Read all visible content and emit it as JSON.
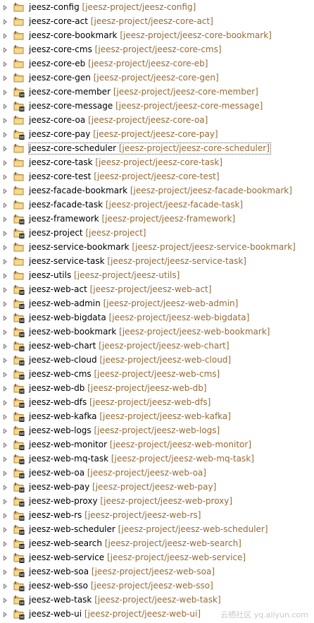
{
  "projects": [
    {
      "name": "jeesz-config",
      "path": "[jeesz-project/jeesz-config]",
      "decorated": false
    },
    {
      "name": "jeesz-core-act",
      "path": "[jeesz-project/jeesz-core-act]",
      "decorated": false
    },
    {
      "name": "jeesz-core-bookmark",
      "path": "[jeesz-project/jeesz-core-bookmark]",
      "decorated": false
    },
    {
      "name": "jeesz-core-cms",
      "path": "[jeesz-project/jeesz-core-cms]",
      "decorated": false
    },
    {
      "name": "jeesz-core-eb",
      "path": "[jeesz-project/jeesz-core-eb]",
      "decorated": false
    },
    {
      "name": "jeesz-core-gen",
      "path": "[jeesz-project/jeesz-core-gen]",
      "decorated": false
    },
    {
      "name": "jeesz-core-member",
      "path": "[jeesz-project/jeesz-core-member]",
      "decorated": true
    },
    {
      "name": "jeesz-core-message",
      "path": "[jeesz-project/jeesz-core-message]",
      "decorated": true
    },
    {
      "name": "jeesz-core-oa",
      "path": "[jeesz-project/jeesz-core-oa]",
      "decorated": false
    },
    {
      "name": "jeesz-core-pay",
      "path": "[jeesz-project/jeesz-core-pay]",
      "decorated": true
    },
    {
      "name": "jeesz-core-scheduler",
      "path": "[jeesz-project/jeesz-core-scheduler]",
      "decorated": false,
      "selected": true
    },
    {
      "name": "jeesz-core-task",
      "path": "[jeesz-project/jeesz-core-task]",
      "decorated": false
    },
    {
      "name": "jeesz-core-test",
      "path": "[jeesz-project/jeesz-core-test]",
      "decorated": false
    },
    {
      "name": "jeesz-facade-bookmark",
      "path": "[jeesz-project/jeesz-facade-bookmark]",
      "decorated": false
    },
    {
      "name": "jeesz-facade-task",
      "path": "[jeesz-project/jeesz-facade-task]",
      "decorated": false
    },
    {
      "name": "jeesz-framework",
      "path": "[jeesz-project/jeesz-framework]",
      "decorated": true
    },
    {
      "name": "jeesz-project",
      "path": "[jeesz-project]",
      "decorated": true
    },
    {
      "name": "jeesz-service-bookmark",
      "path": "[jeesz-project/jeesz-service-bookmark]",
      "decorated": false
    },
    {
      "name": "jeesz-service-task",
      "path": "[jeesz-project/jeesz-service-task]",
      "decorated": false
    },
    {
      "name": "jeesz-utils",
      "path": "[jeesz-project/jeesz-utils]",
      "decorated": false
    },
    {
      "name": "jeesz-web-act",
      "path": "[jeesz-project/jeesz-web-act]",
      "decorated": true
    },
    {
      "name": "jeesz-web-admin",
      "path": "[jeesz-project/jeesz-web-admin]",
      "decorated": true
    },
    {
      "name": "jeesz-web-bigdata",
      "path": "[jeesz-project/jeesz-web-bigdata]",
      "decorated": true
    },
    {
      "name": "jeesz-web-bookmark",
      "path": "[jeesz-project/jeesz-web-bookmark]",
      "decorated": true
    },
    {
      "name": "jeesz-web-chart",
      "path": "[jeesz-project/jeesz-web-chart]",
      "decorated": true
    },
    {
      "name": "jeesz-web-cloud",
      "path": "[jeesz-project/jeesz-web-cloud]",
      "decorated": true
    },
    {
      "name": "jeesz-web-cms",
      "path": "[jeesz-project/jeesz-web-cms]",
      "decorated": true
    },
    {
      "name": "jeesz-web-db",
      "path": "[jeesz-project/jeesz-web-db]",
      "decorated": true
    },
    {
      "name": "jeesz-web-dfs",
      "path": "[jeesz-project/jeesz-web-dfs]",
      "decorated": true
    },
    {
      "name": "jeesz-web-kafka",
      "path": "[jeesz-project/jeesz-web-kafka]",
      "decorated": true
    },
    {
      "name": "jeesz-web-logs",
      "path": "[jeesz-project/jeesz-web-logs]",
      "decorated": true
    },
    {
      "name": "jeesz-web-monitor",
      "path": "[jeesz-project/jeesz-web-monitor]",
      "decorated": true
    },
    {
      "name": "jeesz-web-mq-task",
      "path": "[jeesz-project/jeesz-web-mq-task]",
      "decorated": true
    },
    {
      "name": "jeesz-web-oa",
      "path": "[jeesz-project/jeesz-web-oa]",
      "decorated": true
    },
    {
      "name": "jeesz-web-pay",
      "path": "[jeesz-project/jeesz-web-pay]",
      "decorated": true
    },
    {
      "name": "jeesz-web-proxy",
      "path": "[jeesz-project/jeesz-web-proxy]",
      "decorated": true
    },
    {
      "name": "jeesz-web-rs",
      "path": "[jeesz-project/jeesz-web-rs]",
      "decorated": true
    },
    {
      "name": "jeesz-web-scheduler",
      "path": "[jeesz-project/jeesz-web-scheduler]",
      "decorated": true
    },
    {
      "name": "jeesz-web-search",
      "path": "[jeesz-project/jeesz-web-search]",
      "decorated": true
    },
    {
      "name": "jeesz-web-service",
      "path": "[jeesz-project/jeesz-web-service]",
      "decorated": true
    },
    {
      "name": "jeesz-web-soa",
      "path": "[jeesz-project/jeesz-web-soa]",
      "decorated": true
    },
    {
      "name": "jeesz-web-sso",
      "path": "[jeesz-project/jeesz-web-sso]",
      "decorated": true
    },
    {
      "name": "jeesz-web-task",
      "path": "[jeesz-project/jeesz-web-task]",
      "decorated": true
    },
    {
      "name": "jeesz-web-ui",
      "path": "[jeesz-project/jeesz-web-ui]",
      "decorated": true
    }
  ],
  "icons": {
    "expand": "chevron-right-icon",
    "project": "folder-project-icon",
    "marker": "maven-marker-icon"
  },
  "colors": {
    "path_text": "#956b35",
    "folder": "#e8c06a",
    "folder_dark": "#b08838",
    "marker": "#1a1a1a"
  },
  "watermark": "云栖社区 yq.aliyun.com"
}
